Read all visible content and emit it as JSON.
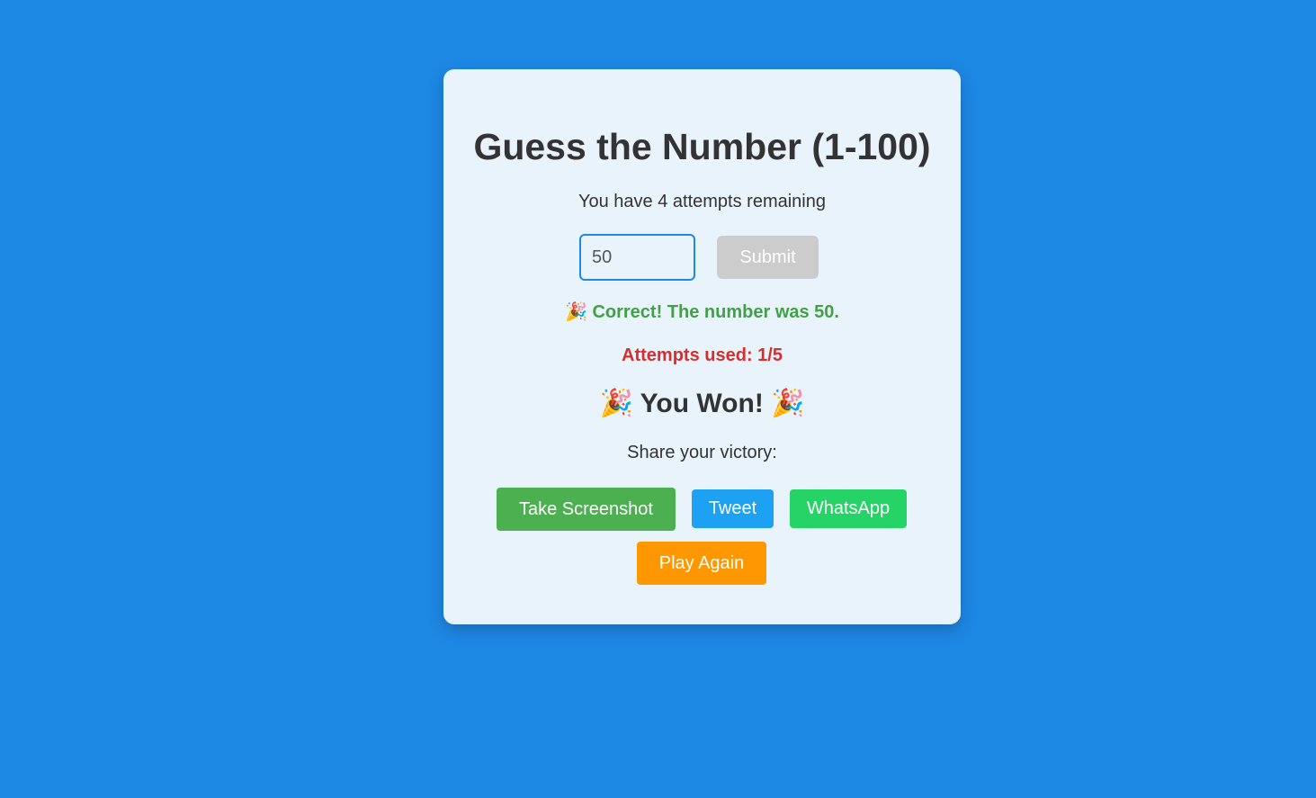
{
  "game": {
    "title": "Guess the Number (1-100)",
    "attempts_remaining_text": "You have 4 attempts remaining",
    "guess_input_value": "50",
    "submit_label": "Submit",
    "result_message": "🎉 Correct! The number was 50.",
    "attempts_used_text": "Attempts used: 1/5",
    "won_heading": "🎉 You Won! 🎉",
    "share_label": "Share your victory:"
  },
  "actions": {
    "screenshot_label": "Take Screenshot",
    "tweet_label": "Tweet",
    "whatsapp_label": "WhatsApp",
    "play_again_label": "Play Again"
  },
  "colors": {
    "page_background": "#1e88e5",
    "card_background": "#e8f3fb",
    "success_text": "#43a047",
    "attempts_used_text": "#d32f2f",
    "submit_disabled": "#cccccc",
    "screenshot_button": "#4caf50",
    "tweet_button": "#1da1f2",
    "whatsapp_button": "#25d366",
    "play_again_button": "#ff9800"
  }
}
